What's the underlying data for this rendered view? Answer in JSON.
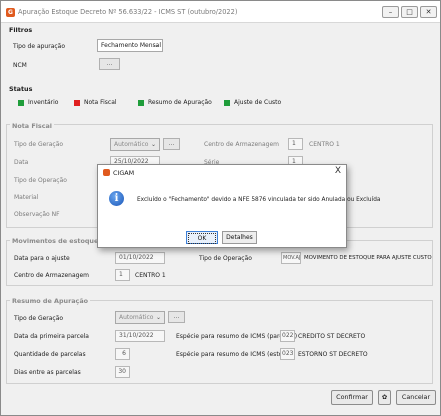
{
  "window": {
    "title": "Apuração Estoque Decreto Nº 56.633/22 - ICMS ST (outubro/2022)",
    "icon_letter": "G",
    "minimize_glyph": "–",
    "maximize_glyph": "□",
    "close_glyph": "✕"
  },
  "filtros": {
    "title": "Filtros",
    "tipo_label": "Tipo de apuração",
    "tipo_value": "Fechamento Mensal",
    "ncm_label": "NCM",
    "ncm_button": "..."
  },
  "status": {
    "title": "Status",
    "items": [
      {
        "label": "Inventário",
        "color": "#1f9d3a"
      },
      {
        "label": "Nota Fiscal",
        "color": "#e02020"
      },
      {
        "label": "Resumo de Apuração",
        "color": "#1f9d3a"
      },
      {
        "label": "Ajuste de Custo",
        "color": "#1f9d3a"
      }
    ]
  },
  "nota_fiscal": {
    "title": "Nota Fiscal",
    "tipo_geracao_label": "Tipo de Geração",
    "tipo_geracao_value": "Automático",
    "tipo_geracao_button": "...",
    "centro_label": "Centro de Armazenagem",
    "centro_code": "1",
    "centro_name": "CENTRO 1",
    "data_label": "Data",
    "data_value": "25/10/2022",
    "serie_label": "Série",
    "serie_value": "1",
    "tipo_operacao_label": "Tipo de Operação",
    "material_label": "Material",
    "observacao_label": "Observação NF"
  },
  "movimentos": {
    "title": "Movimentos de estoque para",
    "data_ajuste_label": "Data para o ajuste",
    "data_ajuste_value": "01/10/2022",
    "tipo_operacao_label": "Tipo de Operação",
    "tipo_operacao_code": "MOV.AJ",
    "tipo_operacao_desc": "MOVIMENTO DE ESTOQUE PARA AJUSTE CUSTO",
    "centro_label": "Centro de Armazenagem",
    "centro_code": "1",
    "centro_name": "CENTRO 1"
  },
  "resumo": {
    "title": "Resumo de Apuração",
    "tipo_geracao_label": "Tipo de Geração",
    "tipo_geracao_value": "Automático",
    "tipo_geracao_button": "...",
    "data_primeira_label": "Data da primeira parcela",
    "data_primeira_value": "31/10/2022",
    "especie_parcelas_label": "Espécie para resumo de ICMS (parcelas)",
    "especie_parcelas_code": "022",
    "especie_parcelas_desc": "CREDITO ST DECRETO",
    "quantidade_label": "Quantidade de parcelas",
    "quantidade_value": "6",
    "especie_estorno_label": "Espécie para resumo de ICMS (estorno)",
    "especie_estorno_code": "023",
    "especie_estorno_desc": "ESTORNO ST DECRETO",
    "dias_label": "Dias entre as parcelas",
    "dias_value": "30"
  },
  "footer": {
    "confirm_label": "Confirmar",
    "gear_glyph": "✿",
    "cancel_label": "Cancelar"
  },
  "dialog": {
    "title": "CIGAM",
    "close_glyph": "X",
    "info_glyph": "i",
    "message": "Excluído o \"Fechamento\" devido a NFE 5876 vinculada ter sido Anulada ou Excluída",
    "ok_label": "OK",
    "details_label": "Detalhes"
  }
}
